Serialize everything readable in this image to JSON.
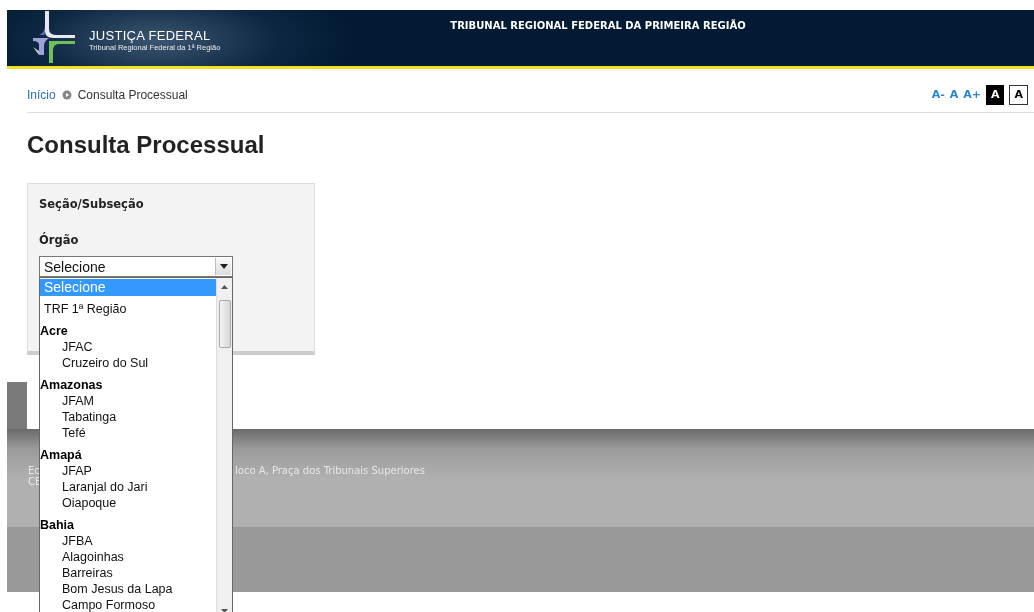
{
  "header": {
    "logo_title": "JUSTIÇA FEDERAL",
    "logo_subtitle": "Tribunal Regional Federal da 1ª Região",
    "title": "TRIBUNAL REGIONAL FEDERAL DA PRIMEIRA REGIÃO"
  },
  "breadcrumb": [
    {
      "label": "Início",
      "kind": "link"
    },
    {
      "label": "Consulta Processual",
      "kind": "current"
    }
  ],
  "font_controls": [
    {
      "label": "A-",
      "kind": "size"
    },
    {
      "label": "A",
      "kind": "size"
    },
    {
      "label": "A+",
      "kind": "size"
    },
    {
      "label": "A",
      "kind": "contrast-dark"
    },
    {
      "label": "A",
      "kind": "contrast-light"
    }
  ],
  "page_title": "Consulta Processual",
  "form": {
    "section_title": "Seção/Subseção",
    "field_label": "Órgão",
    "select": {
      "value": "Selecione",
      "expanded": true,
      "options": [
        {
          "label": "Selecione",
          "kind": "option",
          "selected": true
        },
        {
          "label": "TRF 1ª Região",
          "kind": "option",
          "selected": false
        },
        {
          "label": "Acre",
          "kind": "group",
          "selected": false,
          "children": [
            {
              "label": "JFAC",
              "selected": false
            },
            {
              "label": "Cruzeiro do Sul",
              "selected": false
            }
          ]
        },
        {
          "label": "Amazonas",
          "kind": "group",
          "selected": false,
          "children": [
            {
              "label": "JFAM",
              "selected": false
            },
            {
              "label": "Tabatinga",
              "selected": false
            },
            {
              "label": "Tefé",
              "selected": false
            }
          ]
        },
        {
          "label": "Amapá",
          "kind": "group",
          "selected": false,
          "children": [
            {
              "label": "JFAP",
              "selected": false
            },
            {
              "label": "Laranjal do Jari",
              "selected": false
            },
            {
              "label": "Oiapoque",
              "selected": false
            }
          ]
        },
        {
          "label": "Bahia",
          "kind": "group",
          "selected": false,
          "children": [
            {
              "label": "JFBA",
              "selected": false
            },
            {
              "label": "Alagoinhas",
              "selected": false
            },
            {
              "label": "Barreiras",
              "selected": false
            },
            {
              "label": "Bom Jesus da Lapa",
              "selected": false
            },
            {
              "label": "Campo Formoso",
              "selected": false
            }
          ]
        }
      ]
    }
  },
  "footer": {
    "lines": [
      {
        "segments": [
          "Ec",
          "loco A, Praça dos Tribunais Superiores"
        ]
      },
      {
        "segments": [
          "CE"
        ]
      }
    ]
  }
}
